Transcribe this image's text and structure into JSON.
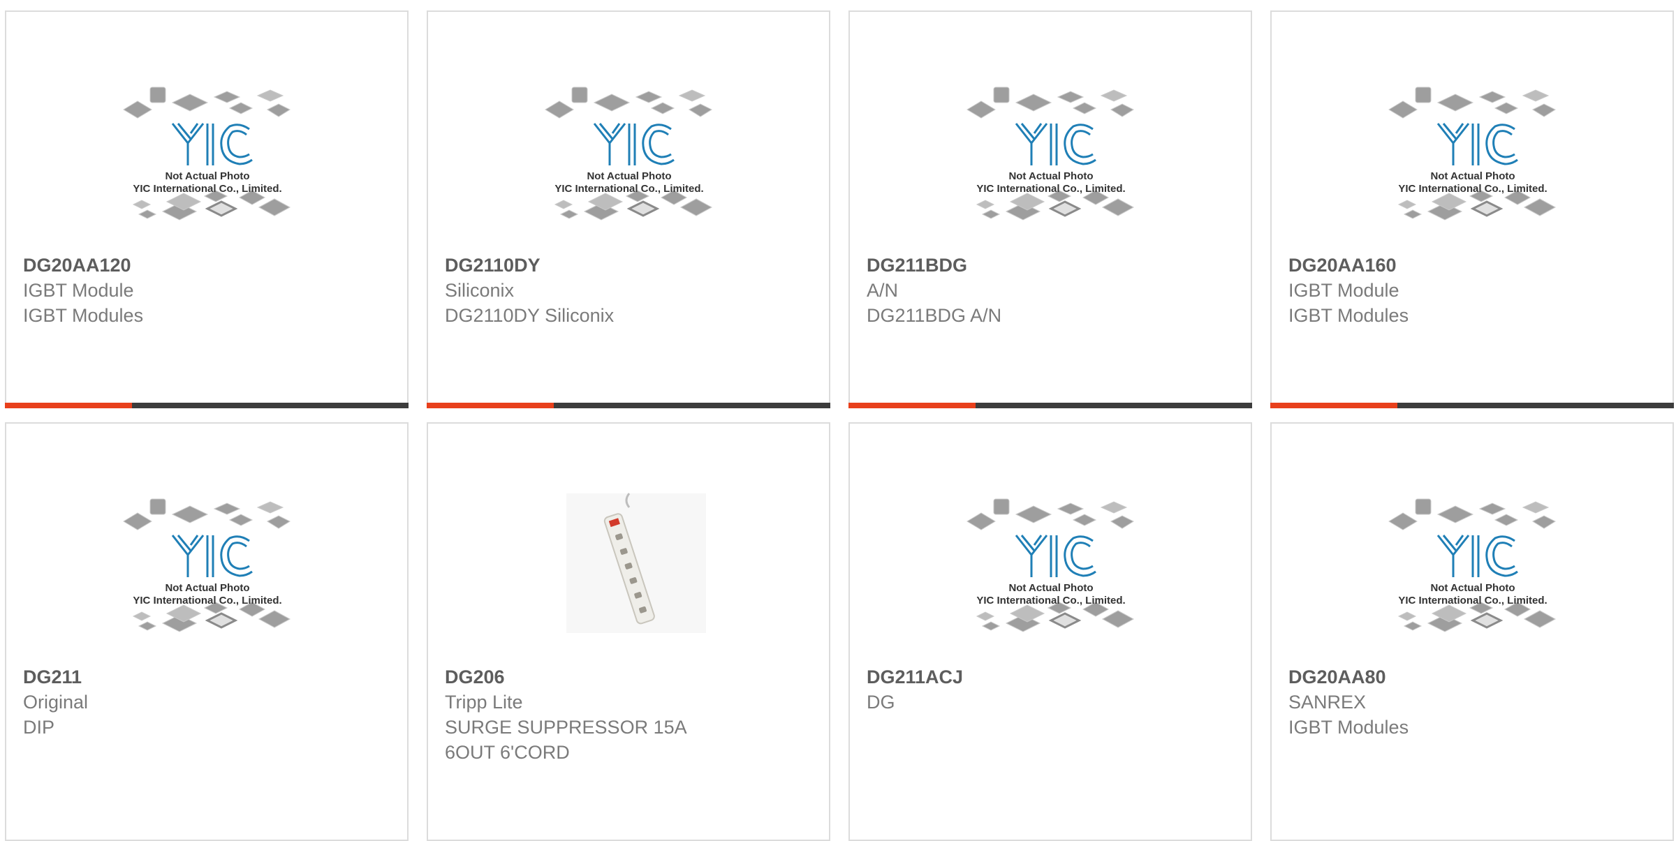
{
  "theme": {
    "accent": "#e8401c",
    "bar": "#3c3c3c",
    "border": "#dcdcdc",
    "text_dark": "#5d5d5d",
    "text_light": "#7a7a7a"
  },
  "placeholder": {
    "caption1": "Not Actual Photo",
    "caption2": "YIC International Co., Limited.",
    "logo": "YIC",
    "icon": "yic-placeholder-icon"
  },
  "products": [
    {
      "part": "DG20AA120",
      "lines": [
        "IGBT Module",
        "IGBT Modules"
      ],
      "image": "placeholder"
    },
    {
      "part": "DG2110DY",
      "lines": [
        "Siliconix",
        "DG2110DY Siliconix"
      ],
      "image": "placeholder"
    },
    {
      "part": "DG211BDG",
      "lines": [
        "A/N",
        "DG211BDG A/N"
      ],
      "image": "placeholder"
    },
    {
      "part": "DG20AA160",
      "lines": [
        "IGBT Module",
        "IGBT Modules"
      ],
      "image": "placeholder"
    },
    {
      "part": "DG211",
      "lines": [
        "Original",
        "DIP"
      ],
      "image": "placeholder"
    },
    {
      "part": "DG206",
      "lines": [
        "Tripp Lite",
        "SURGE SUPPRESSOR 15A",
        "6OUT 6'CORD"
      ],
      "image": "power-strip"
    },
    {
      "part": "DG211ACJ",
      "lines": [
        "DG"
      ],
      "image": "placeholder"
    },
    {
      "part": "DG20AA80",
      "lines": [
        "SANREX",
        "IGBT Modules"
      ],
      "image": "placeholder"
    }
  ]
}
